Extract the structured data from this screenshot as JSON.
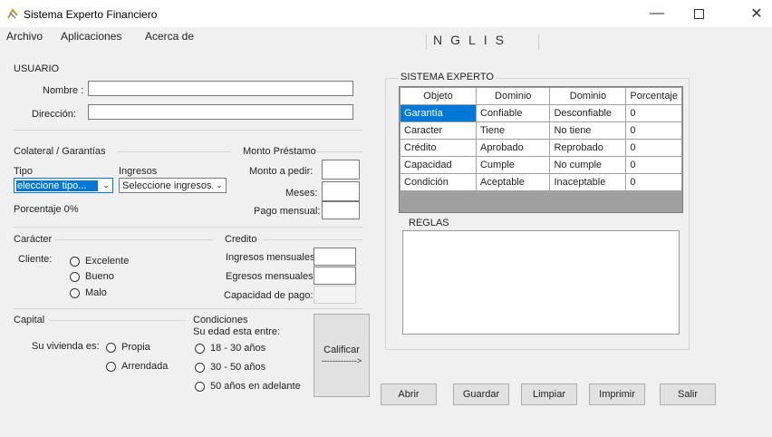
{
  "window": {
    "title": "Sistema Experto Financiero"
  },
  "menu": [
    "Archivo",
    "Aplicaciones",
    "Acerca de"
  ],
  "brand": "NGLIS",
  "usuario": {
    "section": "USUARIO",
    "nombre_label": "Nombre :",
    "nombre_value": "",
    "direccion_label": "Dirección:",
    "direccion_value": ""
  },
  "colateral": {
    "section": "Colateral / Garantías",
    "tipo_label": "Tipo",
    "ingresos_label": "Ingresos",
    "tipo_select": "eleccione tipo...",
    "ingresos_select": "Seleccione ingresos...",
    "porcentaje": "Porcentaje 0%"
  },
  "monto": {
    "section": "Monto Préstamo",
    "monto_label": "Monto a pedir:",
    "meses_label": "Meses:",
    "pago_label": "Pago mensual:"
  },
  "caracter": {
    "section": "Carácter",
    "cliente_label": "Cliente:",
    "options": [
      "Excelente",
      "Bueno",
      "Malo"
    ]
  },
  "credito": {
    "section": "Credito",
    "ingresos_label": "Ingresos mensuales:",
    "egresos_label": "Egresos mensuales:",
    "capacidad_label": "Capacidad de pago:"
  },
  "capital": {
    "section": "Capital",
    "vivienda_label": "Su vivienda es:",
    "options": [
      "Propia",
      "Arrendada"
    ]
  },
  "condiciones": {
    "section": "Condiciones",
    "subtitle": "Su edad esta entre:",
    "options": [
      "18 - 30 años",
      "30 - 50 años",
      "50 años en adelante"
    ]
  },
  "calificar": {
    "label": "Calificar",
    "arrow": "------------->"
  },
  "sistema": {
    "section": "SISTEMA EXPERTO",
    "columns": [
      "Objeto",
      "Dominio",
      "Dominio",
      "Porcentaje"
    ],
    "rows": [
      [
        "Garantía",
        "Confiable",
        "Desconfiable",
        "0"
      ],
      [
        "Caracter",
        "Tiene",
        "No tiene",
        "0"
      ],
      [
        "Crédito",
        "Aprobado",
        "Reprobado",
        "0"
      ],
      [
        "Capacidad",
        "Cumple",
        "No cumple",
        "0"
      ],
      [
        "Condición",
        "Aceptable",
        "Inaceptable",
        "0"
      ]
    ]
  },
  "reglas": {
    "section": "REGLAS"
  },
  "buttons": [
    "Abrir",
    "Guardar",
    "Limpiar",
    "Imprimir",
    "Salir"
  ],
  "colors": {
    "accent": "#0078d7",
    "window_bg": "#f0f0f0",
    "grid_empty": "#a0a0a0"
  }
}
